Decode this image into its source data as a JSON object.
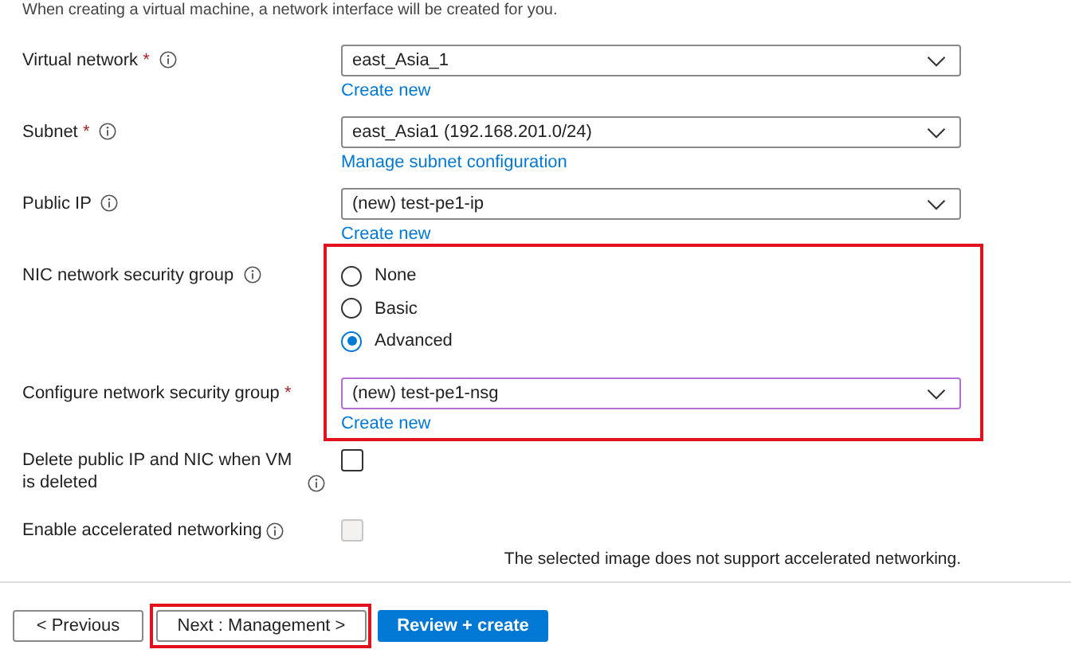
{
  "intro": "When creating a virtual machine, a network interface will be created for you.",
  "fields": [
    {
      "kind": "select",
      "label": "Virtual network",
      "required_mark": "*",
      "info": true,
      "value": "east_Asia_1",
      "link": "Create new",
      "highlighted": false,
      "focused": false
    },
    {
      "kind": "select",
      "label": "Subnet",
      "required_mark": "*",
      "info": true,
      "value": "east_Asia1 (192.168.201.0/24)",
      "link": "Manage subnet configuration",
      "highlighted": false,
      "focused": false
    },
    {
      "kind": "select",
      "label": "Public IP",
      "info": true,
      "value": "(new) test-pe1-ip",
      "link": "Create new",
      "highlighted": false,
      "focused": false
    },
    {
      "kind": "radio",
      "label": "NIC network security group",
      "info": true,
      "highlighted": true,
      "options": [
        {
          "label": "None",
          "selected": false
        },
        {
          "label": "Basic",
          "selected": false
        },
        {
          "label": "Advanced",
          "selected": true
        }
      ]
    },
    {
      "kind": "select",
      "label": "Configure network security group",
      "required_mark": "*",
      "info": false,
      "value": "(new) test-pe1-nsg",
      "link": "Create new",
      "highlighted": true,
      "focused": true
    },
    {
      "kind": "checkbox",
      "label": "Delete public IP and NIC when VM is deleted",
      "info": true,
      "checked": false,
      "disabled": false,
      "highlighted": false
    },
    {
      "kind": "checkbox",
      "label": "Enable accelerated networking",
      "info": true,
      "checked": false,
      "disabled": true,
      "note": "The selected image does not support accelerated networking.",
      "highlighted": false
    }
  ],
  "buttons": [
    {
      "label": "< Previous",
      "kind": "secondary",
      "highlighted": false
    },
    {
      "label": "Next : Management >",
      "kind": "secondary",
      "highlighted": true
    },
    {
      "label": "Review + create",
      "kind": "primary",
      "highlighted": false
    }
  ]
}
